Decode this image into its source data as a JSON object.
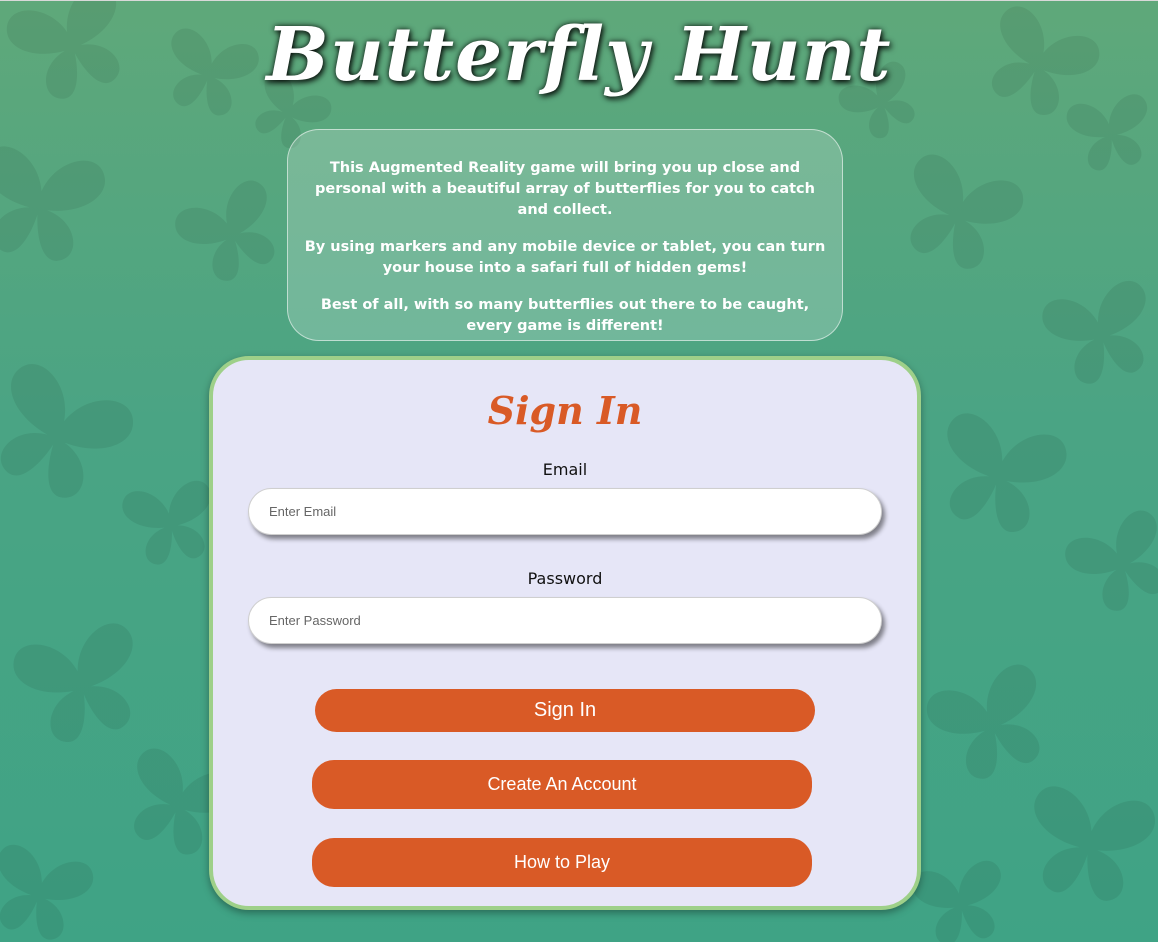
{
  "app": {
    "title": "Butterfly Hunt"
  },
  "intro": {
    "paragraphs": [
      "This Augmented Reality game will bring you up close and personal with a beautiful array of butterflies for you to catch and collect.",
      "By using markers and any mobile device or tablet, you can turn your house into a safari full of hidden gems!",
      "Best of all, with so many butterflies out there to be caught, every game is different!"
    ]
  },
  "signin": {
    "title": "Sign In",
    "email_label": "Email",
    "email_placeholder": "Enter Email",
    "email_value": "",
    "password_label": "Password",
    "password_placeholder": "Enter Password",
    "password_value": "",
    "signin_button": "Sign In",
    "create_account_button": "Create An Account",
    "how_to_play_button": "How to Play"
  },
  "colors": {
    "accent": "#d95a26",
    "card_background": "#e6e6f7",
    "card_border": "#9ed089",
    "page_background": "#4aa484"
  },
  "background": {
    "pattern_icon": "butterfly-silhouette-icon"
  }
}
